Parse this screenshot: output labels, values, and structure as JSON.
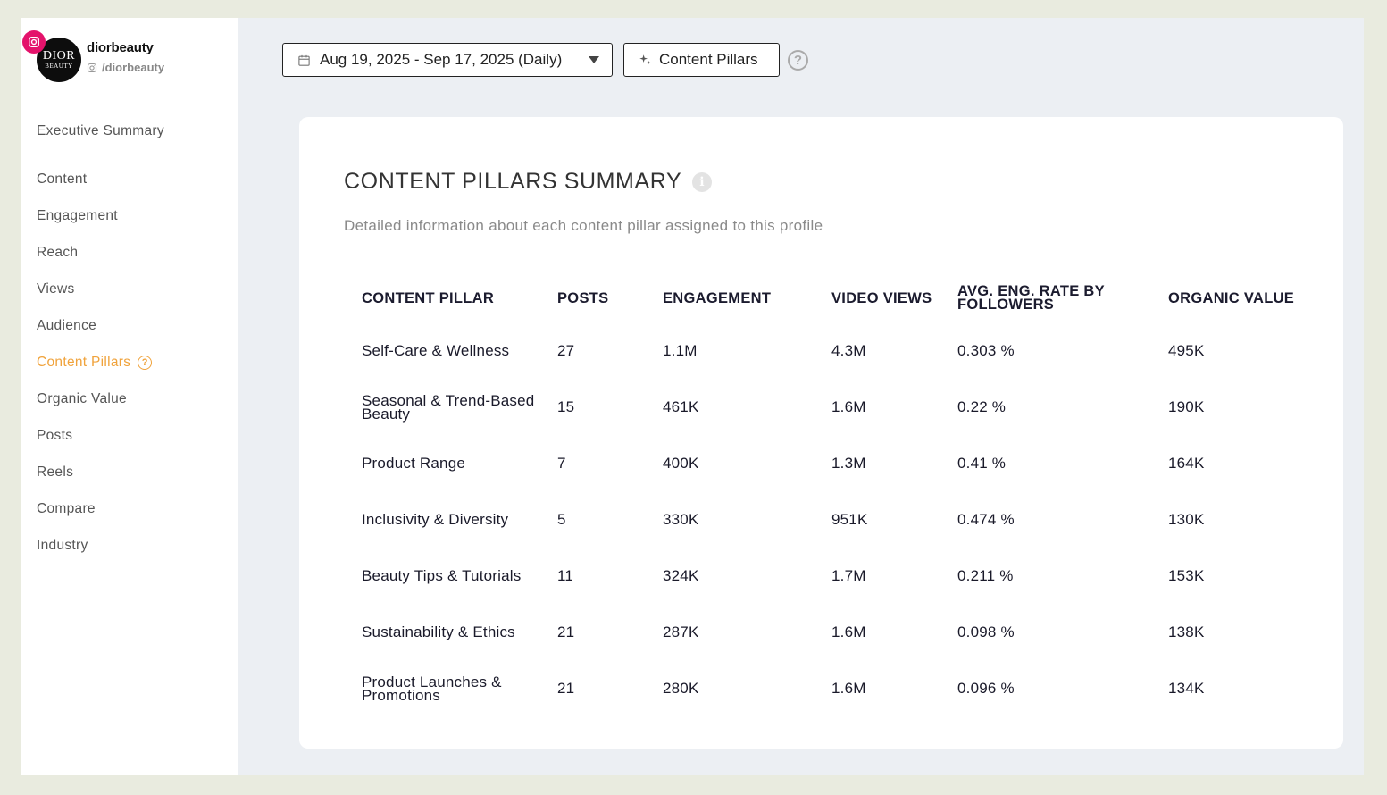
{
  "profile": {
    "name": "diorbeauty",
    "handle": "/diorbeauty",
    "avatar_line1": "DIOR",
    "avatar_line2": "BEAUTY",
    "platform_icon": "instagram-icon"
  },
  "nav": {
    "executive_summary": "Executive Summary",
    "items": [
      "Content",
      "Engagement",
      "Reach",
      "Views",
      "Audience"
    ],
    "active": "Content Pillars",
    "items_after": [
      "Organic Value",
      "Posts",
      "Reels",
      "Compare",
      "Industry"
    ]
  },
  "toolbar": {
    "date_range": "Aug 19, 2025 - Sep 17, 2025 (Daily)",
    "pillars_button": "Content Pillars",
    "help": "?"
  },
  "card": {
    "title": "CONTENT PILLARS SUMMARY",
    "subtitle": "Detailed information about each content pillar assigned to this profile",
    "info": "i"
  },
  "table": {
    "headers": [
      "CONTENT PILLAR",
      "POSTS",
      "ENGAGEMENT",
      "VIDEO VIEWS",
      "AVG. ENG. RATE BY FOLLOWERS",
      "ORGANIC VALUE"
    ],
    "rows": [
      [
        "Self-Care & Wellness",
        "27",
        "1.1M",
        "4.3M",
        "0.303 %",
        "495K"
      ],
      [
        "Seasonal & Trend-Based Beauty",
        "15",
        "461K",
        "1.6M",
        "0.22 %",
        "190K"
      ],
      [
        "Product Range",
        "7",
        "400K",
        "1.3M",
        "0.41 %",
        "164K"
      ],
      [
        "Inclusivity & Diversity",
        "5",
        "330K",
        "951K",
        "0.474 %",
        "130K"
      ],
      [
        "Beauty Tips & Tutorials",
        "11",
        "324K",
        "1.7M",
        "0.211 %",
        "153K"
      ],
      [
        "Sustainability & Ethics",
        "21",
        "287K",
        "1.6M",
        "0.098 %",
        "138K"
      ],
      [
        "Product Launches & Promotions",
        "21",
        "280K",
        "1.6M",
        "0.096 %",
        "134K"
      ]
    ]
  },
  "colors": {
    "accent": "#f0a33c",
    "instagram": "#e4136b",
    "background": "#eceff3"
  }
}
